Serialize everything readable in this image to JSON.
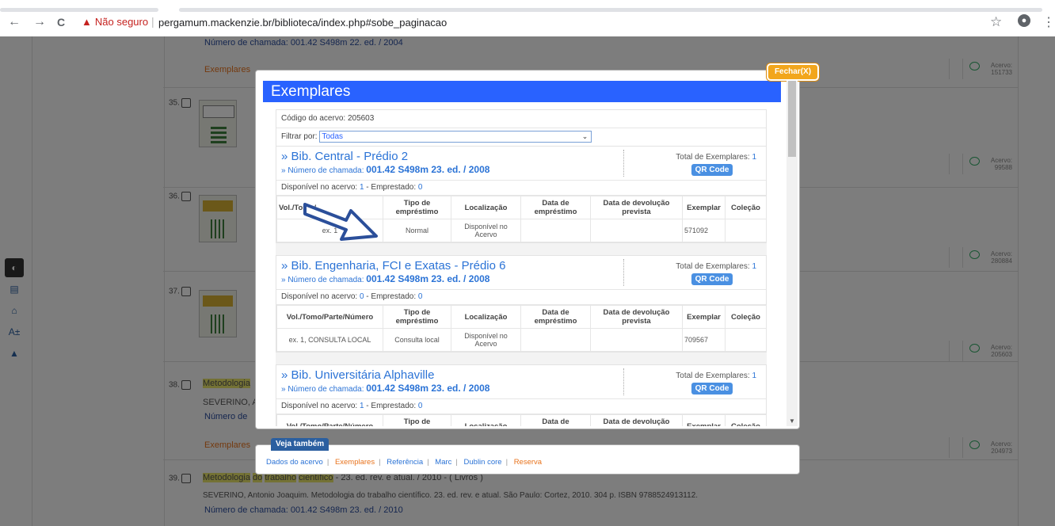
{
  "browser": {
    "back": "←",
    "forward": "→",
    "reload": "C",
    "security_warning": "Não seguro",
    "url": "pergamum.mackenzie.br/biblioteca/index.php#sobe_paginacao"
  },
  "background": {
    "call_top": "Número de chamada: 001.42 S498m 22. ed. / 2004",
    "exemplares_label": "Exemplares",
    "rows": [
      {
        "num": "35.",
        "acervo": "Acervo: 151733"
      },
      {
        "num": "36.",
        "acervo": "Acervo: 99588"
      },
      {
        "num": "37.",
        "acervo": "Acervo: 280884"
      },
      {
        "num": "38.",
        "acervo": "Acervo: 205603"
      },
      {
        "num": "39.",
        "acervo": "Acervo: 204973"
      }
    ],
    "r38_title": "Metodologia",
    "r38_author": "SEVERINO, Ant",
    "r38_call": "Número de",
    "r39_title_a": "Metodologia",
    "r39_title_b": "do",
    "r39_title_c": "trabalho",
    "r39_title_d": "científico",
    "r39_title_rest": "- 23. ed. rev. e atual. / 2010 - ( Livros )",
    "r39_ref": "SEVERINO, Antonio Joaquim. Metodologia do trabalho científico. 23. ed. rev. e atual. São Paulo: Cortez, 2010. 304 p. ISBN 9788524913112.",
    "r39_call": "Número de chamada: 001.42 S498m 23. ed. / 2010"
  },
  "modal": {
    "close_label": "Fechar(X)",
    "title": "Exemplares",
    "acervo_code": "Código do acervo: 205603",
    "filter_label": "Filtrar por:",
    "filter_value": "Todas",
    "columns": [
      "Vol./Tomo/Parte/Número",
      "Tipo de empréstimo",
      "Localização",
      "Data de empréstimo",
      "Data de devolução prevista",
      "Exemplar",
      "Coleção"
    ],
    "col1_partial": "Vol./Tomo/",
    "libraries": [
      {
        "name": "» Bib. Central - Prédio 2",
        "call_prefix": "» Número de chamada:",
        "call": "001.42 S498m 23. ed. / 2008",
        "total_label": "Total de Exemplares:",
        "total": "1",
        "qr": "QR Code",
        "avail_label": "Disponível no acervo:",
        "avail": "1",
        "loan_label": "- Emprestado:",
        "loan": "0",
        "row": {
          "vol": "ex. 1",
          "tipo": "Normal",
          "loc": "Disponível no Acervo",
          "data": "",
          "dev": "",
          "exemplar": "571092",
          "colecao": ""
        }
      },
      {
        "name": "» Bib. Engenharia, FCI e Exatas - Prédio 6",
        "call_prefix": "» Número de chamada:",
        "call": "001.42 S498m 23. ed. / 2008",
        "total_label": "Total de Exemplares:",
        "total": "1",
        "qr": "QR Code",
        "avail_label": "Disponível no acervo:",
        "avail": "0",
        "loan_label": "- Emprestado:",
        "loan": "0",
        "row": {
          "vol": "ex. 1, CONSULTA LOCAL",
          "tipo": "Consulta local",
          "loc": "Disponível no Acervo",
          "data": "",
          "dev": "",
          "exemplar": "709567",
          "colecao": ""
        }
      },
      {
        "name": "» Bib. Universitária Alphaville",
        "call_prefix": "» Número de chamada:",
        "call": "001.42 S498m 23. ed. / 2008",
        "total_label": "Total de Exemplares:",
        "total": "1",
        "qr": "QR Code",
        "avail_label": "Disponível no acervo:",
        "avail": "1",
        "loan_label": "- Emprestado:",
        "loan": "0"
      }
    ]
  },
  "veja": {
    "title": "Veja também",
    "links": [
      "Dados do acervo",
      "Exemplares",
      "Referência",
      "Marc",
      "Dublin core",
      "Reserva"
    ]
  }
}
